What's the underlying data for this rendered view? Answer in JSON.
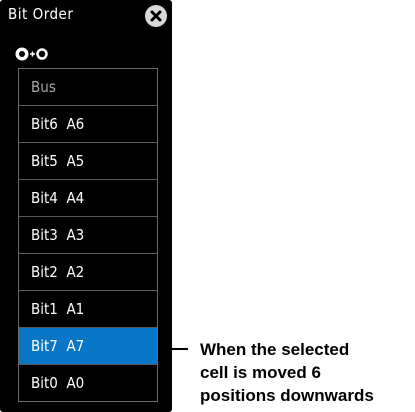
{
  "panel": {
    "title": "Bit Order",
    "close_icon": "close-x-icon",
    "knob_icon": "rotary-knob-push-icon"
  },
  "rows": [
    {
      "label": "Bus"
    },
    {
      "label": "Bit6  A6"
    },
    {
      "label": "Bit5  A5"
    },
    {
      "label": "Bit4  A4"
    },
    {
      "label": "Bit3  A3"
    },
    {
      "label": "Bit2  A2"
    },
    {
      "label": "Bit1  A1"
    },
    {
      "label": "Bit7  A7",
      "selected": true
    },
    {
      "label": "Bit0  A0"
    }
  ],
  "annotation": {
    "lines": [
      "When the selected",
      "cell is moved 6",
      "positions downwards"
    ]
  },
  "colors": {
    "selected": "#0a76c8",
    "panel_bg": "#000000"
  }
}
